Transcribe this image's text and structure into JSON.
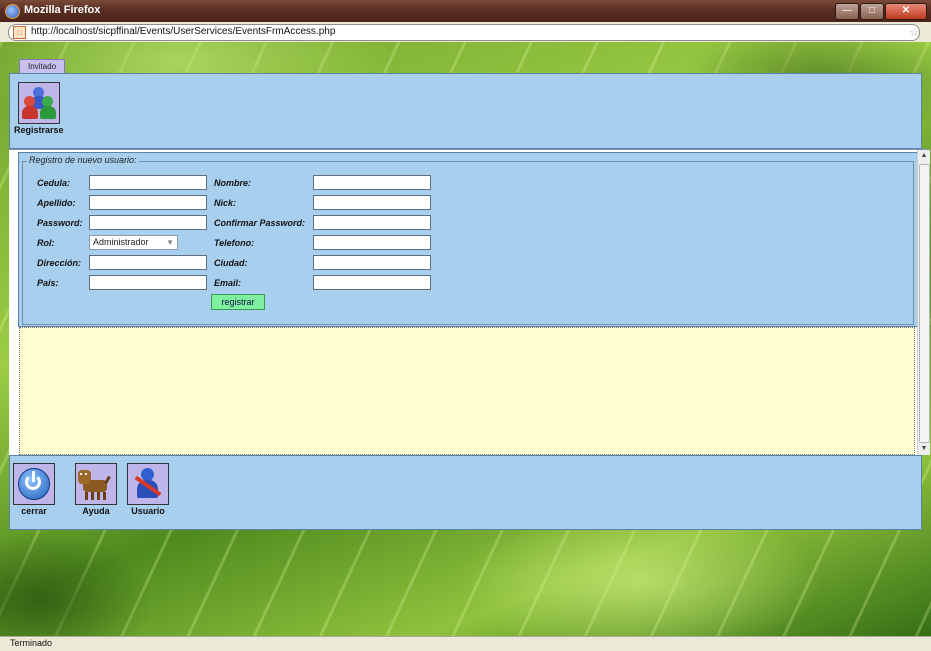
{
  "window": {
    "title": "Mozilla Firefox",
    "url": "http://localhost/sicpffinal/Events/UserServices/EventsFrmAccess.php"
  },
  "tab": {
    "label": "Invitado"
  },
  "toolbar": {
    "register_label": "Registrarse"
  },
  "form": {
    "legend": "Registro de nuevo usuario:",
    "labels": {
      "cedula": "Cedula:",
      "apellido": "Apellido:",
      "password": "Password:",
      "rol": "Rol:",
      "direccion": "Dirección:",
      "pais": "Pais:",
      "nombre": "Nombre:",
      "nick": "Nick:",
      "confirmar_password": "Confirmar Password:",
      "telefono": "Telefono:",
      "ciudad": "Ciudad:",
      "email": "Email:"
    },
    "values": {
      "cedula": "",
      "apellido": "",
      "password": "",
      "direccion": "",
      "pais": "",
      "nombre": "",
      "nick": "",
      "confirmar_password": "",
      "telefono": "",
      "ciudad": "",
      "email": ""
    },
    "rol_selected": "Administrador",
    "submit_label": "registrar"
  },
  "bottom_toolbar": {
    "cerrar_label": "cerrar",
    "ayuda_label": "Ayuda",
    "usuario_label": "Usuario"
  },
  "status": {
    "text": "Terminado"
  },
  "colors": {
    "panel": "#a8cfee",
    "message_area": "#ffffd2",
    "submit_button": "#7ff0a0",
    "tab": "#c9c0ef",
    "icon_bg": "#c0b5e8"
  }
}
